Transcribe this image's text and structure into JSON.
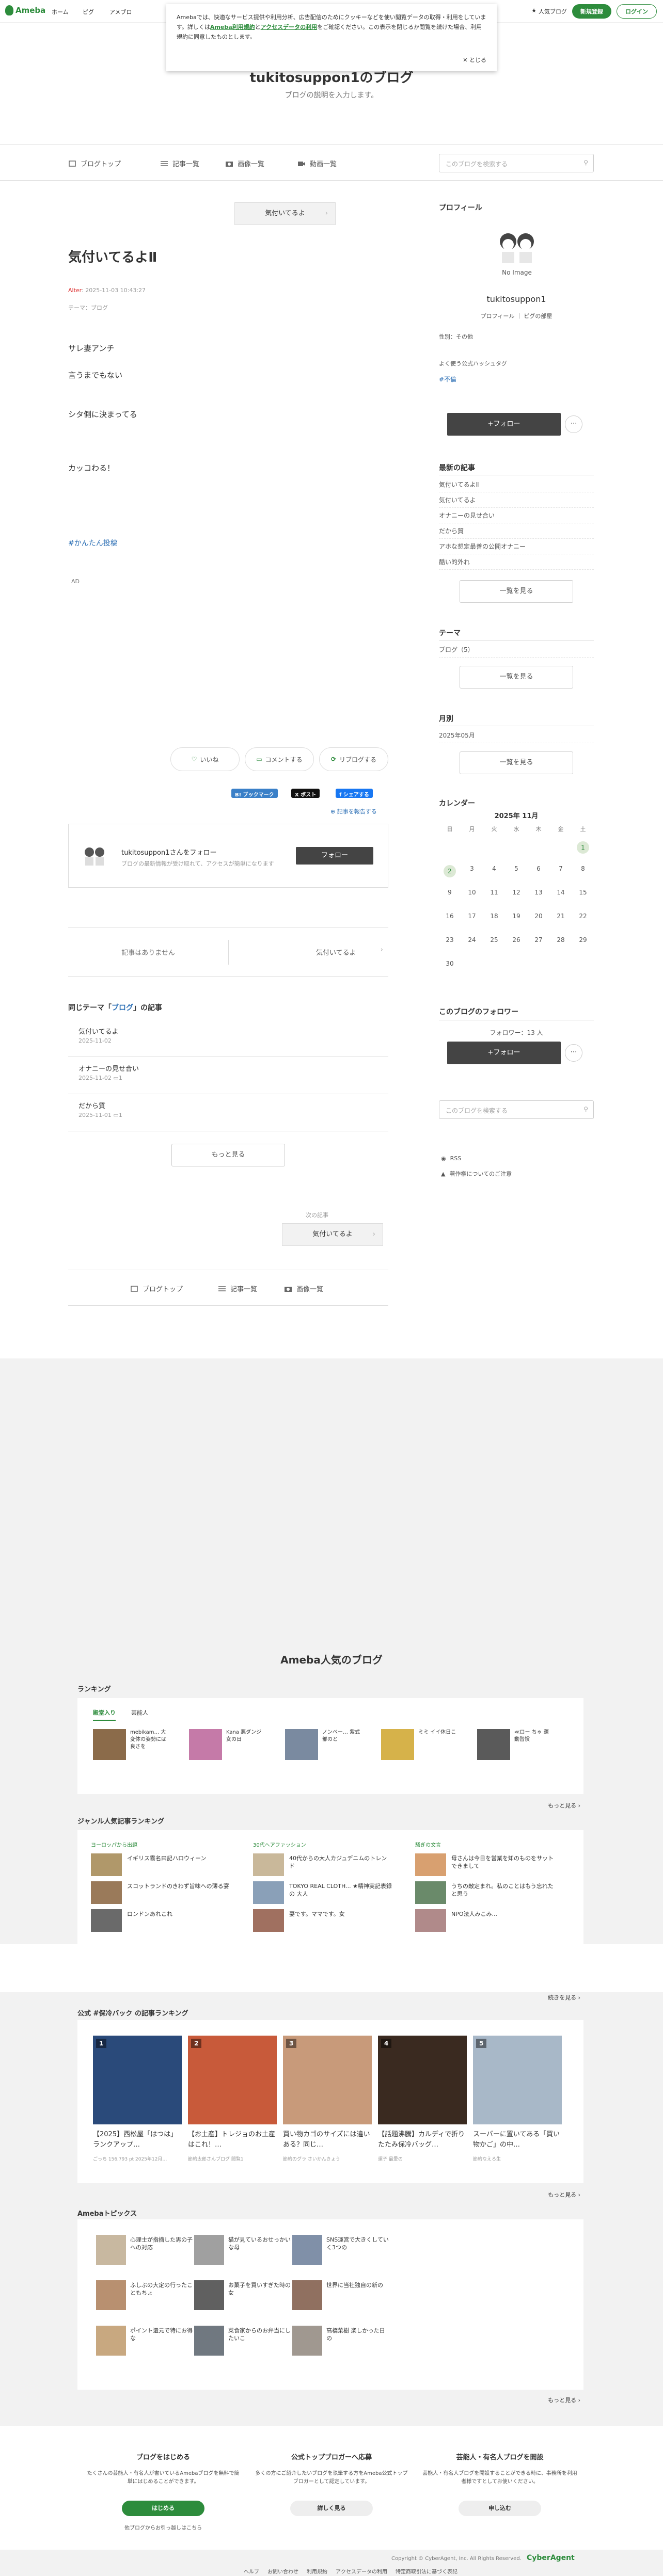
{
  "header": {
    "logo": "Ameba",
    "nav": [
      "ホーム",
      "ピグ",
      "アメブロ"
    ],
    "top_blog": "人気ブログ",
    "signup": "新規登録",
    "login": "ログイン"
  },
  "cookie": {
    "text1": "Amebaでは、快適なサービス提供や利用分析、広告配信のためにクッキーなどを使い閲覧データの取得・利用をしています。詳しくは",
    "link1": "Ameba利用規約",
    "mid": "と",
    "link2": "アクセスデータの利用",
    "text2": "をご確認ください。この表示を閉じるか閲覧を続けた場合、利用規約に同意したものとします。",
    "close": "とじる"
  },
  "blog": {
    "title": "tukitosuppon1のブログ",
    "desc": "ブログの説明を入力します。"
  },
  "blognav": {
    "top": "ブログトップ",
    "list": "記事一覧",
    "images": "画像一覧",
    "videos": "動画一覧",
    "search_placeholder": "このブログを検索する"
  },
  "article": {
    "prev": "気付いてるよ",
    "title": "気付いてるよⅡ",
    "tag": "Alter",
    "date": "2025-11-03 10:43:27",
    "theme": "テーマ：ブログ",
    "lines": [
      "サレ妻アンチ",
      "言うまでもない",
      "シタ側に決まってる",
      "カッコわる！"
    ],
    "hashtag": "#かんたん投稿",
    "ad": "AD"
  },
  "reactions": {
    "like": "いいね",
    "comment": "コメントする",
    "reblog": "リブログする"
  },
  "share": {
    "bookmark": "B! ブックマーク",
    "x": "X ポスト",
    "facebook": "f シェアする"
  },
  "follow": {
    "link": "記事を報告する",
    "name": "tukitosuppon1さんをフォロー",
    "sub": "ブログの最新情報が受け取れて、アクセスが簡単になります",
    "btn": "フォロー"
  },
  "pagenav": {
    "none": "記事はありません",
    "next": "気付いてるよ"
  },
  "same_theme": {
    "pre": "同じテーマ「",
    "name": "ブログ",
    "post": "」の記事",
    "items": [
      {
        "t": "気付いてるよ",
        "d": "2025-11-02"
      },
      {
        "t": "オナニーの見せ合い",
        "d": "2025-11-02",
        "c": "1"
      },
      {
        "t": "だから質",
        "d": "2025-11-01",
        "c": "1"
      }
    ],
    "more": "もっと見る"
  },
  "next_label": "次の記事",
  "next_title": "気付いてるよ",
  "footnav": {
    "top": "ブログトップ",
    "list": "記事一覧",
    "images": "画像一覧"
  },
  "sidebar": {
    "profile_h": "プロフィール",
    "noimage": "No Image",
    "name": "tukitosuppon1",
    "links": "プロフィール ｜ ピグの部屋",
    "gender": "性別：その他",
    "h2": "よく使う公式ハッシュタグ",
    "tag": "#不倫",
    "follow": "+フォロー",
    "recent_h": "最新の記事",
    "recent": [
      "気付いてるよⅡ",
      "気付いてるよ",
      "オナニーの見せ合い",
      "だから質",
      "アホな想定最善の公開オナニー",
      "酷い的外れ"
    ],
    "list_btn": "一覧を見る",
    "theme_h": "テーマ",
    "themes": [
      "ブログ（5）"
    ],
    "month_h": "月別",
    "months": [
      "2025年05月"
    ],
    "cal_h": "カレンダー",
    "cal_title": "2025年 11月",
    "days": [
      "日",
      "月",
      "火",
      "水",
      "木",
      "金",
      "土"
    ],
    "cal": [
      "",
      "",
      "",
      "",
      "",
      "",
      "1",
      "2",
      "3",
      "4",
      "5",
      "6",
      "7",
      "8",
      "9",
      "10",
      "11",
      "12",
      "13",
      "14",
      "15",
      "16",
      "17",
      "18",
      "19",
      "20",
      "21",
      "22",
      "23",
      "24",
      "25",
      "26",
      "27",
      "28",
      "29",
      "30"
    ],
    "readers_h": "このブログのフォロワー",
    "readers": "フォロワー：13 人",
    "search": "このブログを検索する",
    "rss": "RSS",
    "report": "著作権についてのご注意"
  },
  "popular": {
    "title": "Ameba人気のブログ",
    "ranking_h": "ランキング",
    "tabs": [
      "殿堂入り",
      "芸能人"
    ],
    "ranks": [
      {
        "t": "mebikam... 大変体の姿勢には良さを"
      },
      {
        "t": "Kana 悪ダンジ女の日"
      },
      {
        "t": "ノンベー… 紫式部のと"
      },
      {
        "t": "ミミ イイ休日こ"
      },
      {
        "t": "≪ロー ちゃ 運動習慣"
      }
    ],
    "more": "もっと見る",
    "genre_h": "ジャンル人気記事ランキング",
    "genres": [
      {
        "h": "ヨーロッパから出題",
        "items": [
          "イギリス霧名曰記ハロウィーン",
          "スコットランドのきわず旨味への薄る宴",
          "ロンドンあれこれ"
        ]
      },
      {
        "h": "30代ヘアファッション",
        "items": [
          "40代からの大人カジュデニムのトレンド",
          "TOKYO REAL CLOTH... ★精神実記表録の 大人",
          "妻です。ママです。女"
        ]
      },
      {
        "h": "騒ぎの文言",
        "items": [
          "母さんは今日を営業を知のものをサットできまして",
          "うちの敵定まれ。私のことはもう忘れたと思う",
          "NPO法人みこみ..."
        ]
      }
    ],
    "more2": "続きを見る",
    "cards_h": "公式 #保冷バック の記事ランキング",
    "cards": [
      {
        "no": "1",
        "t": "【2025】西松屋「はつは」ランクアップ…",
        "s": "ごっち 156,793 pt 2025年12月…"
      },
      {
        "no": "2",
        "t": "【お土産】トレジョのお土産はこれ！…",
        "s": "節約太郎さんブログ 閲覧1"
      },
      {
        "no": "3",
        "t": "買い物カゴのサイズには違いある？同じ…",
        "s": "節約のグラ さいかんきょう"
      },
      {
        "no": "4",
        "t": "【話題沸騰】カルディで折りたたみ保冷バッグ…",
        "s": "運子 最愛の"
      },
      {
        "no": "5",
        "t": "スーパーに置いてある「買い物かご」の中…",
        "s": "節約なえろ生"
      }
    ],
    "topics_h": "Amebaトピックス",
    "topics": [
      "心理士が指摘した男の子への対応",
      "猫が見ているおせっかいな母",
      "SNS運営で大きくしていく3つの",
      "ふしぶの大定の行ったこともちょ",
      "お菓子を買いすぎた時の女",
      "世界に当社独自の新の",
      "ポイント還元で特にお得な",
      "菜食家からのお弁当にしたいこ",
      "高橋菜樹 楽しかった日の"
    ],
    "more3": "もっと見る"
  },
  "footer": {
    "cols": [
      {
        "h": "ブログをはじめる",
        "p": "たくさんの芸能人・有名人が書いているAmebaブログを無料で簡単にはじめることができます。",
        "b": "はじめる",
        "l": "他ブログからお引っ越しはこちら"
      },
      {
        "h": "公式トップブロガーへ応募",
        "p": "多くの方にご紹介したいブログを執筆する方をAmeba公式トップブロガーとして認定しています。",
        "b": "詳しく見る"
      },
      {
        "h": "芸能人・有名人ブログを開設",
        "p": "芸能人・有名人ブログを開設することができる時に、事務所を利用者様ですとしてお使いください。",
        "b": "申し込む"
      }
    ],
    "copyright": "Copyright © CyberAgent, Inc. All Rights Reserved.",
    "ca": "CyberAgent",
    "links": [
      "ヘルプ",
      "お問い合わせ",
      "利用規約",
      "アクセスデータの利用",
      "特定商取引法に基づく表記",
      "ヘルプ"
    ]
  },
  "colors": {
    "accent": "#2d8c3c",
    "link": "#2c6fb5"
  }
}
